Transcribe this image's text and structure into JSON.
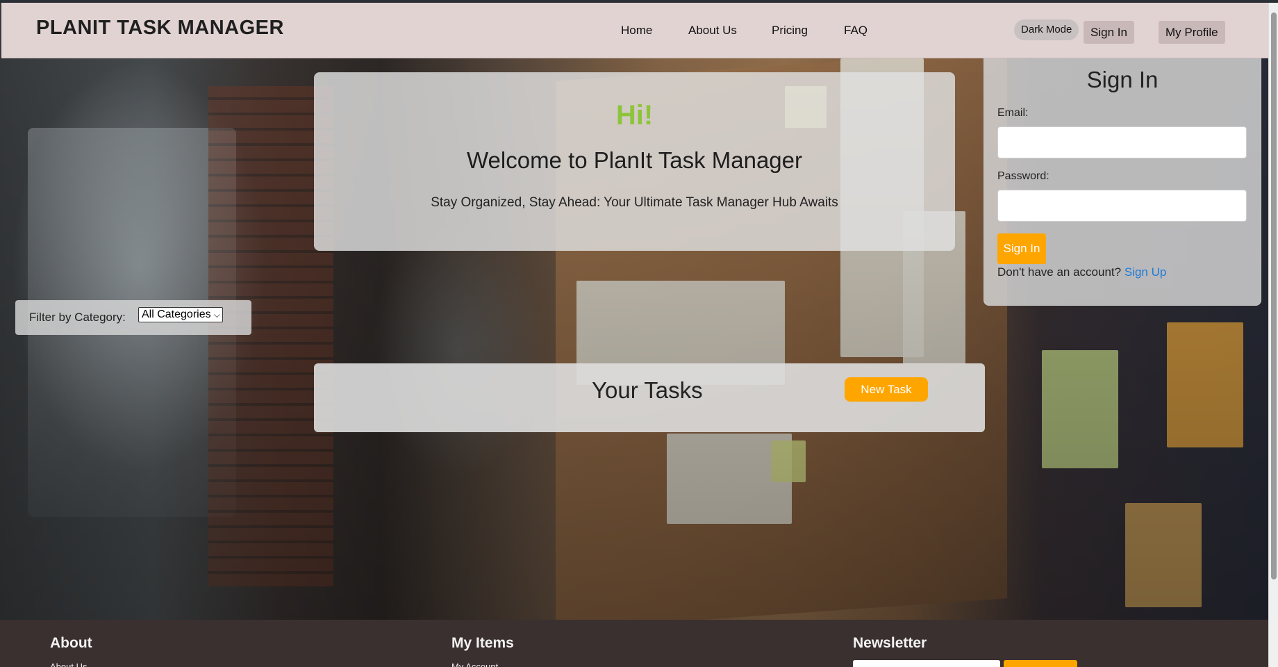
{
  "header": {
    "brand": "PLANIT TASK MANAGER",
    "nav": [
      "Home",
      "About Us",
      "Pricing",
      "FAQ"
    ],
    "dark_mode_label": "Dark Mode",
    "sign_in_label": "Sign In",
    "profile_label": "My Profile"
  },
  "hero": {
    "greeting": "Hi!",
    "welcome": "Welcome to PlanIt Task Manager",
    "tagline": "Stay Organized, Stay Ahead: Your Ultimate Task Manager Hub Awaits"
  },
  "filter": {
    "label": "Filter by Category:",
    "selected": "All Categories"
  },
  "signin": {
    "title": "Sign In",
    "email_label": "Email:",
    "email_value": "",
    "password_label": "Password:",
    "password_value": "",
    "submit_label": "Sign In",
    "no_account_text": "Don't have an account?",
    "signup_link": "Sign Up"
  },
  "tasks": {
    "title": "Your Tasks",
    "new_task_label": "New Task"
  },
  "footer": {
    "about_title": "About",
    "about_link": "About Us",
    "items_title": "My Items",
    "items_link": "My Account",
    "newsletter_title": "Newsletter"
  },
  "colors": {
    "header_bg": "#e2d3d3",
    "accent": "#ffa500",
    "greeting": "#8dc43b",
    "link": "#1e7bd8",
    "footer_bg": "#3a302f"
  }
}
